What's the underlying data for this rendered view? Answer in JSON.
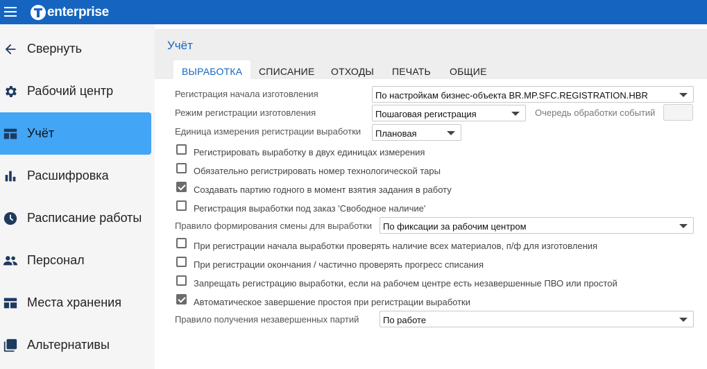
{
  "app": {
    "logo_text": "enterprise",
    "brand_color": "#1565c0",
    "accent_color": "#42a5f5"
  },
  "sidebar": {
    "items": [
      {
        "label": "Свернуть",
        "icon": "arrow-left-icon"
      },
      {
        "label": "Рабочий центр",
        "icon": "gear-icon"
      },
      {
        "label": "Учёт",
        "icon": "table-icon",
        "active": true
      },
      {
        "label": "Расшифровка",
        "icon": "bar-chart-icon"
      },
      {
        "label": "Расписание работы",
        "icon": "clock-icon"
      },
      {
        "label": "Персонал",
        "icon": "people-icon"
      },
      {
        "label": "Места хранения",
        "icon": "storage-icon"
      },
      {
        "label": "Альтернативы",
        "icon": "library-icon"
      }
    ]
  },
  "page": {
    "title": "Учёт",
    "tabs": [
      {
        "label": "ВЫРАБОТКА",
        "active": true
      },
      {
        "label": "СПИСАНИЕ"
      },
      {
        "label": "ОТХОДЫ"
      },
      {
        "label": "ПЕЧАТЬ"
      },
      {
        "label": "ОБЩИЕ"
      }
    ]
  },
  "form": {
    "start_registration": {
      "label": "Регистрация начала изготовления",
      "value": "По настройкам бизнес-объекта BR.MP.SFC.REGISTRATION.HBR"
    },
    "registration_mode": {
      "label": "Режим регистрации изготовления",
      "value": "Пошаговая регистрация"
    },
    "event_queue": {
      "label": "Очередь обработки событий",
      "value": ""
    },
    "unit_of_measure": {
      "label": "Единица измерения регистрации выработки",
      "value": "Плановая"
    },
    "checkboxes_a": [
      {
        "label": "Регистрировать выработку в двух единицах измерения",
        "checked": false
      },
      {
        "label": "Обязательно регистрировать номер технологической тары",
        "checked": false
      },
      {
        "label": "Создавать партию годного в момент взятия задания в работу",
        "checked": true
      },
      {
        "label": "Регистрация выработки под заказ 'Свободное наличие'",
        "checked": false
      }
    ],
    "shift_rule": {
      "label": "Правило формирования смены для выработки",
      "value": "По фиксации за рабочим центром"
    },
    "checkboxes_b": [
      {
        "label": "При регистрации начала выработки проверять наличие всех материалов, п/ф для изготовления",
        "checked": false
      },
      {
        "label": "При регистрации окончания / частично проверять прогресс списания",
        "checked": false
      },
      {
        "label": "Запрещать регистрацию выработки, если на рабочем центре есть незавершенные ПВО или простой",
        "checked": false
      },
      {
        "label": "Автоматическое завершение простоя при регистрации выработки",
        "checked": true
      }
    ],
    "unfinished_batches_rule": {
      "label": "Правило получения незавершенных партий",
      "value": "По работе"
    }
  }
}
